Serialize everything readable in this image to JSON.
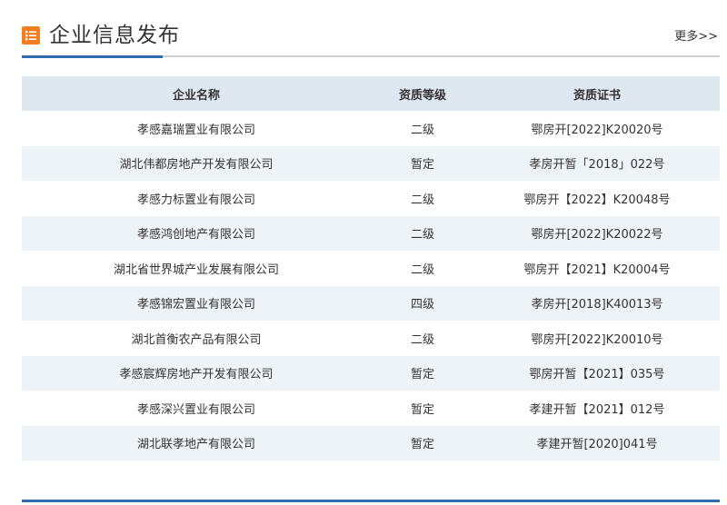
{
  "header": {
    "icon": "list-icon",
    "title": "企业信息发布",
    "more_label": "更多>>"
  },
  "colors": {
    "accent": "#2f6bb3",
    "icon_bg": "#f47d20",
    "table_header_bg": "#dfe8f1",
    "row_alt_bg": "#eef3f8"
  },
  "table": {
    "columns": [
      "企业名称",
      "资质等级",
      "资质证书"
    ],
    "rows": [
      {
        "name": "孝感嘉瑞置业有限公司",
        "level": "二级",
        "cert": "鄂房开[2022]K20020号"
      },
      {
        "name": "湖北伟都房地产开发有限公司",
        "level": "暂定",
        "cert": "孝房开暂「2018」022号"
      },
      {
        "name": "孝感力标置业有限公司",
        "level": "二级",
        "cert": "鄂房开【2022】K20048号"
      },
      {
        "name": "孝感鸿创地产有限公司",
        "level": "二级",
        "cert": "鄂房开[2022]K20022号"
      },
      {
        "name": "湖北省世界城产业发展有限公司",
        "level": "二级",
        "cert": "鄂房开【2021】K20004号"
      },
      {
        "name": "孝感锦宏置业有限公司",
        "level": "四级",
        "cert": "孝房开[2018]K40013号"
      },
      {
        "name": "湖北首衡农产品有限公司",
        "level": "二级",
        "cert": "鄂房开[2022]K20010号"
      },
      {
        "name": "孝感宸辉房地产开发有限公司",
        "level": "暂定",
        "cert": "鄂房开暂【2021】035号"
      },
      {
        "name": "孝感深兴置业有限公司",
        "level": "暂定",
        "cert": "孝建开暂【2021】012号"
      },
      {
        "name": "湖北联孝地产有限公司",
        "level": "暂定",
        "cert": "孝建开暂[2020]041号"
      }
    ]
  }
}
